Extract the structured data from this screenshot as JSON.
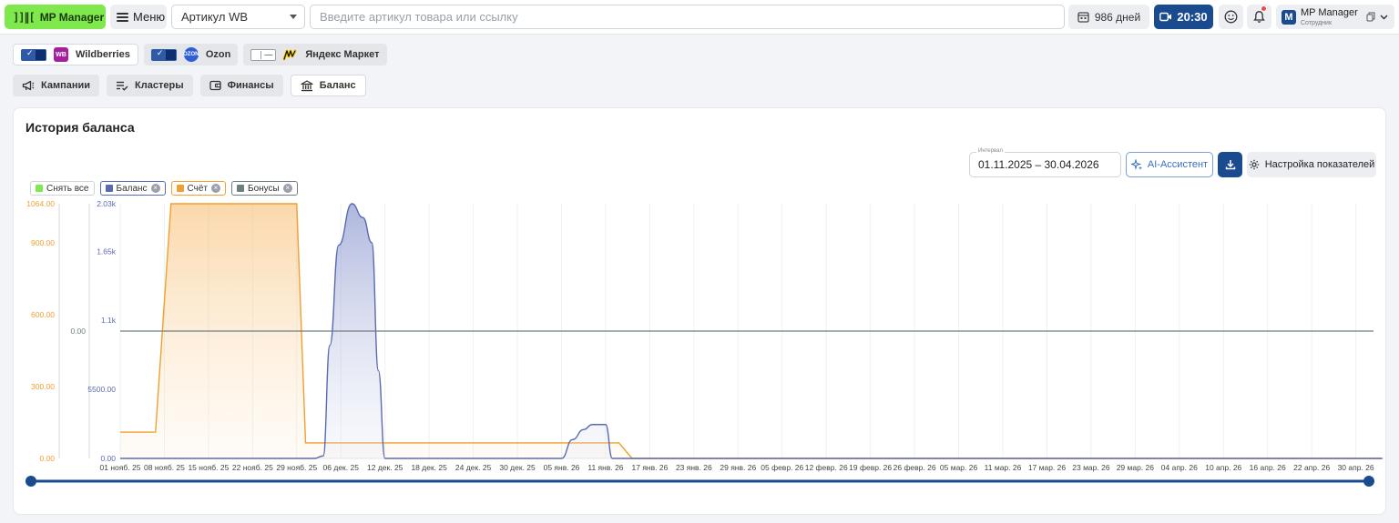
{
  "topbar": {
    "logo_glyph": "]]∥[",
    "logo_label": "MP Manager",
    "menu_label": "Меню",
    "article_select": "Артикул WB",
    "search_placeholder": "Введите артикул товара или ссылку",
    "days_label": "986 дней",
    "time_label": "20:30",
    "user_name": "MP Manager",
    "user_role": "Сотрудник",
    "user_initial": "M"
  },
  "marketplaces": [
    {
      "name": "Wildberries",
      "logo": "WB",
      "enabled": true
    },
    {
      "name": "Ozon",
      "logo": "OZON",
      "enabled": true
    },
    {
      "name": "Яндекс Маркет",
      "logo": "Я",
      "enabled": false
    }
  ],
  "nav": {
    "tabs": [
      {
        "label": "Кампании",
        "icon": "megaphone-icon",
        "active": false
      },
      {
        "label": "Кластеры",
        "icon": "list-check-icon",
        "active": false
      },
      {
        "label": "Финансы",
        "icon": "wallet-icon",
        "active": false
      },
      {
        "label": "Баланс",
        "icon": "bank-icon",
        "active": true
      }
    ]
  },
  "card": {
    "title": "История баланса",
    "interval_label": "Интервал",
    "interval_value": "01.11.2025 – 30.04.2026",
    "ai_label": "AI-Ассистент",
    "settings_label": "Настройка показателей"
  },
  "legend": [
    {
      "label": "Снять все",
      "color": "#7ee84c",
      "removable": false
    },
    {
      "label": "Баланс",
      "color": "#5b6bb0",
      "removable": true
    },
    {
      "label": "Счёт",
      "color": "#f0a030",
      "removable": true
    },
    {
      "label": "Бонусы",
      "color": "#6e7f80",
      "removable": true
    }
  ],
  "colors": {
    "balance": "#5b6bb0",
    "account": "#f0a030",
    "bonus": "#6e7f80",
    "brand_green": "#7ee84c",
    "brand_blue": "#1a4b8f"
  },
  "chart_data": {
    "type": "area",
    "categories": [
      "01 нояб. 25",
      "08 нояб. 25",
      "15 нояб. 25",
      "22 нояб. 25",
      "29 нояб. 25",
      "06 дек. 25",
      "12 дек. 25",
      "18 дек. 25",
      "24 дек. 25",
      "30 дек. 25",
      "05 янв. 26",
      "11 янв. 26",
      "17 янв. 26",
      "23 янв. 26",
      "29 янв. 26",
      "05 февр. 26",
      "12 февр. 26",
      "19 февр. 26",
      "26 февр. 26",
      "05 мар. 26",
      "11 мар. 26",
      "17 мар. 26",
      "23 мар. 26",
      "29 мар. 26",
      "04 апр. 26",
      "10 апр. 26",
      "16 апр. 26",
      "22 апр. 26",
      "30 апр. 26"
    ],
    "axes": {
      "account": {
        "ticks": [
          "1064.00",
          "900.00",
          "600.00",
          "300.00",
          "0.00"
        ],
        "ylim": [
          0,
          1064
        ]
      },
      "bonus": {
        "ticks": [
          "0.00"
        ]
      },
      "balance": {
        "ticks": [
          "2.03k",
          "1.65k",
          "1.1k",
          "5500.00",
          "0.00"
        ],
        "ylim": [
          0,
          2030
        ]
      }
    },
    "series": [
      {
        "name": "Счёт",
        "points": [
          [
            0,
            110
          ],
          [
            0.8,
            110
          ],
          [
            1.15,
            1064
          ],
          [
            4.0,
            1064
          ],
          [
            4.2,
            65
          ],
          [
            11.0,
            65
          ],
          [
            11.3,
            65
          ],
          [
            11.6,
            0
          ],
          [
            28.6,
            0
          ]
        ]
      },
      {
        "name": "Баланс",
        "points": [
          [
            0,
            0
          ],
          [
            4.4,
            0
          ],
          [
            4.6,
            20
          ],
          [
            4.75,
            900
          ],
          [
            4.95,
            1700
          ],
          [
            5.25,
            2030
          ],
          [
            5.5,
            1920
          ],
          [
            5.7,
            1720
          ],
          [
            5.85,
            700
          ],
          [
            6.0,
            0
          ],
          [
            10.0,
            0
          ],
          [
            10.25,
            150
          ],
          [
            10.5,
            230
          ],
          [
            10.7,
            270
          ],
          [
            11.0,
            270
          ],
          [
            11.15,
            0
          ],
          [
            28.6,
            0
          ]
        ]
      },
      {
        "name": "Бонусы",
        "points": [
          [
            0,
            0
          ],
          [
            28.6,
            0
          ]
        ]
      }
    ]
  }
}
